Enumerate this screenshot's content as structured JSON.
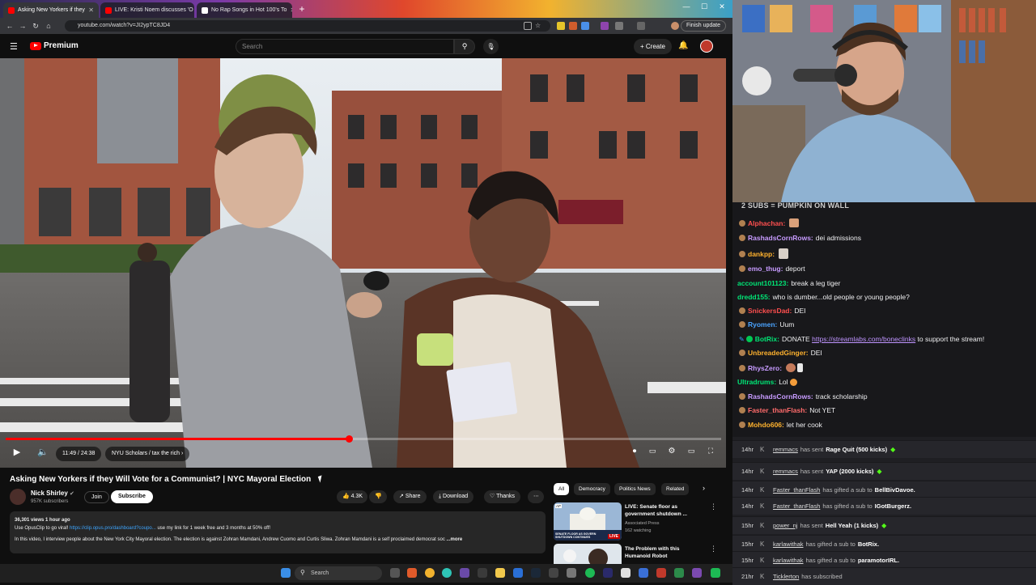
{
  "browser": {
    "tabs": [
      {
        "title": "Asking New Yorkers if they",
        "active": true
      },
      {
        "title": "LIVE: Kristi Noem discusses 'O",
        "active": false
      },
      {
        "title": "No Rap Songs in Hot 100's To",
        "active": false
      }
    ],
    "url": "youtube.com/watch?v=JI2ypTC8JD4",
    "finish_update": "Finish update"
  },
  "youtube": {
    "logo": "Premium",
    "search_placeholder": "Search",
    "create": "Create"
  },
  "player": {
    "time": "11:49 / 24:38",
    "chapter": "NYU Scholars / tax the rich",
    "progress": 0.48,
    "hd_badge": "HD"
  },
  "video": {
    "title": "Asking New Yorkers if they Will Vote for a Communist? | NYC Mayoral Election",
    "channel": "Nick Shirley",
    "subscribers": "957K subscribers",
    "join": "Join",
    "subscribe": "Subscribe",
    "likes": "4.3K",
    "share": "Share",
    "download": "Download",
    "thanks": "Thanks",
    "stats": "36,301 views  1 hour ago",
    "desc_line1_pre": "Use OpusClip to go viral! ",
    "desc_line1_link": "https://clip.opus.pro/dashboard?coupo...",
    "desc_line1_post": " use my link for 1 week free and 3 months at 50% off!",
    "desc_line2": "In this video, I interview people about the New York City Mayoral election. The election is against Zohran Mamdani, Andrew Cuomo and Curtis Sliwa. Zohran Mamdani is a self proclaimed democrat soc",
    "desc_more": "...more"
  },
  "recommendations": {
    "chips": [
      "All",
      "Democracy",
      "Politics News",
      "Related"
    ],
    "items": [
      {
        "title": "LIVE: Senate floor as government shutdown ...",
        "channel": "Associated Press",
        "meta": "162 watching",
        "badge": "LIVE",
        "thumb_label": "SENATE FLOOR AS GOVERN SHUTDOWN CONTINUES"
      },
      {
        "title": "The Problem with this Humanoid Robot",
        "channel": "",
        "meta": "",
        "badge": "",
        "thumb_label": ""
      }
    ]
  },
  "chat": {
    "goal": "2 SUBS = PUMPKIN ON WALL",
    "messages": [
      {
        "user": "Alphachan:",
        "text": "",
        "color": "#ff4f4f",
        "badge": "#b08050"
      },
      {
        "user": "RashadsCornRows:",
        "text": "dei admissions",
        "color": "#c79bff",
        "badge": "#b08050"
      },
      {
        "user": "dankpp:",
        "text": "",
        "color": "#ffb22e",
        "badge": "#b08050"
      },
      {
        "user": "emo_thug:",
        "text": "deport",
        "color": "#c79bff",
        "badge": "#b08050"
      },
      {
        "user": "account101123:",
        "text": "break a leg tiger",
        "color": "#00e676",
        "badge": ""
      },
      {
        "user": "dredd155:",
        "text": "who is dumber...old people or young people?",
        "color": "#00e676",
        "badge": ""
      },
      {
        "user": "SnickersDad:",
        "text": "DEI",
        "color": "#ff4f4f",
        "badge": "#b08050"
      },
      {
        "user": "Ryomen:",
        "text": "Uum",
        "color": "#4aa3ff",
        "badge": "#b08050"
      },
      {
        "user": "BotRix:",
        "text": "DONATE",
        "link": "https://streamlabs.com/boneclinks",
        "after": "to support the stream!",
        "color": "#00e676",
        "badge": "#3aa0ff"
      },
      {
        "user": "UnbreadedGinger:",
        "text": "DEI",
        "color": "#ffb22e",
        "badge": "#b08050"
      },
      {
        "user": "RhysZero:",
        "text": "",
        "color": "#c79bff",
        "badge": "#b08050"
      },
      {
        "user": "Ultradrums:",
        "text": "Lol",
        "color": "#00e676",
        "badge": ""
      },
      {
        "user": "RashadsCornRows:",
        "text": "track scholarship",
        "color": "#c79bff",
        "badge": "#b08050"
      },
      {
        "user": "Faster_thanFlash:",
        "text": "Not YET",
        "color": "#ff6b6b",
        "badge": "#b08050"
      },
      {
        "user": "Mohdo606:",
        "text": "let her cook",
        "color": "#ffb22e",
        "badge": "#b08050"
      }
    ]
  },
  "alerts": [
    {
      "time": "14hr",
      "user": "remmacs",
      "action": "has sent",
      "highlight": "Rage Quit (500 kicks)",
      "gem": true
    },
    {
      "time": "14hr",
      "user": "remmacs",
      "action": "has sent",
      "highlight": "YAP (2000 kicks)",
      "gem": true
    },
    {
      "time": "14hr",
      "user": "Faster_thanFlash",
      "action": "has gifted a sub to",
      "highlight": "BellBivDavoe.",
      "gem": false
    },
    {
      "time": "14hr",
      "user": "Faster_thanFlash",
      "action": "has gifted a sub to",
      "highlight": "IGotBurgerz.",
      "gem": false
    },
    {
      "time": "15hr",
      "user": "power_nj",
      "action": "has sent",
      "highlight": "Hell Yeah (1 kicks)",
      "gem": true
    },
    {
      "time": "15hr",
      "user": "karlawithak",
      "action": "has gifted a sub to",
      "highlight": "BotRix.",
      "gem": false
    },
    {
      "time": "15hr",
      "user": "karlawithak",
      "action": "has gifted a sub to",
      "highlight": "paramotorIRL.",
      "gem": false
    },
    {
      "time": "21hr",
      "user": "Ticklerton",
      "action": "has subscribed",
      "highlight": "",
      "gem": false
    }
  ],
  "taskbar": {
    "search": "Search"
  }
}
